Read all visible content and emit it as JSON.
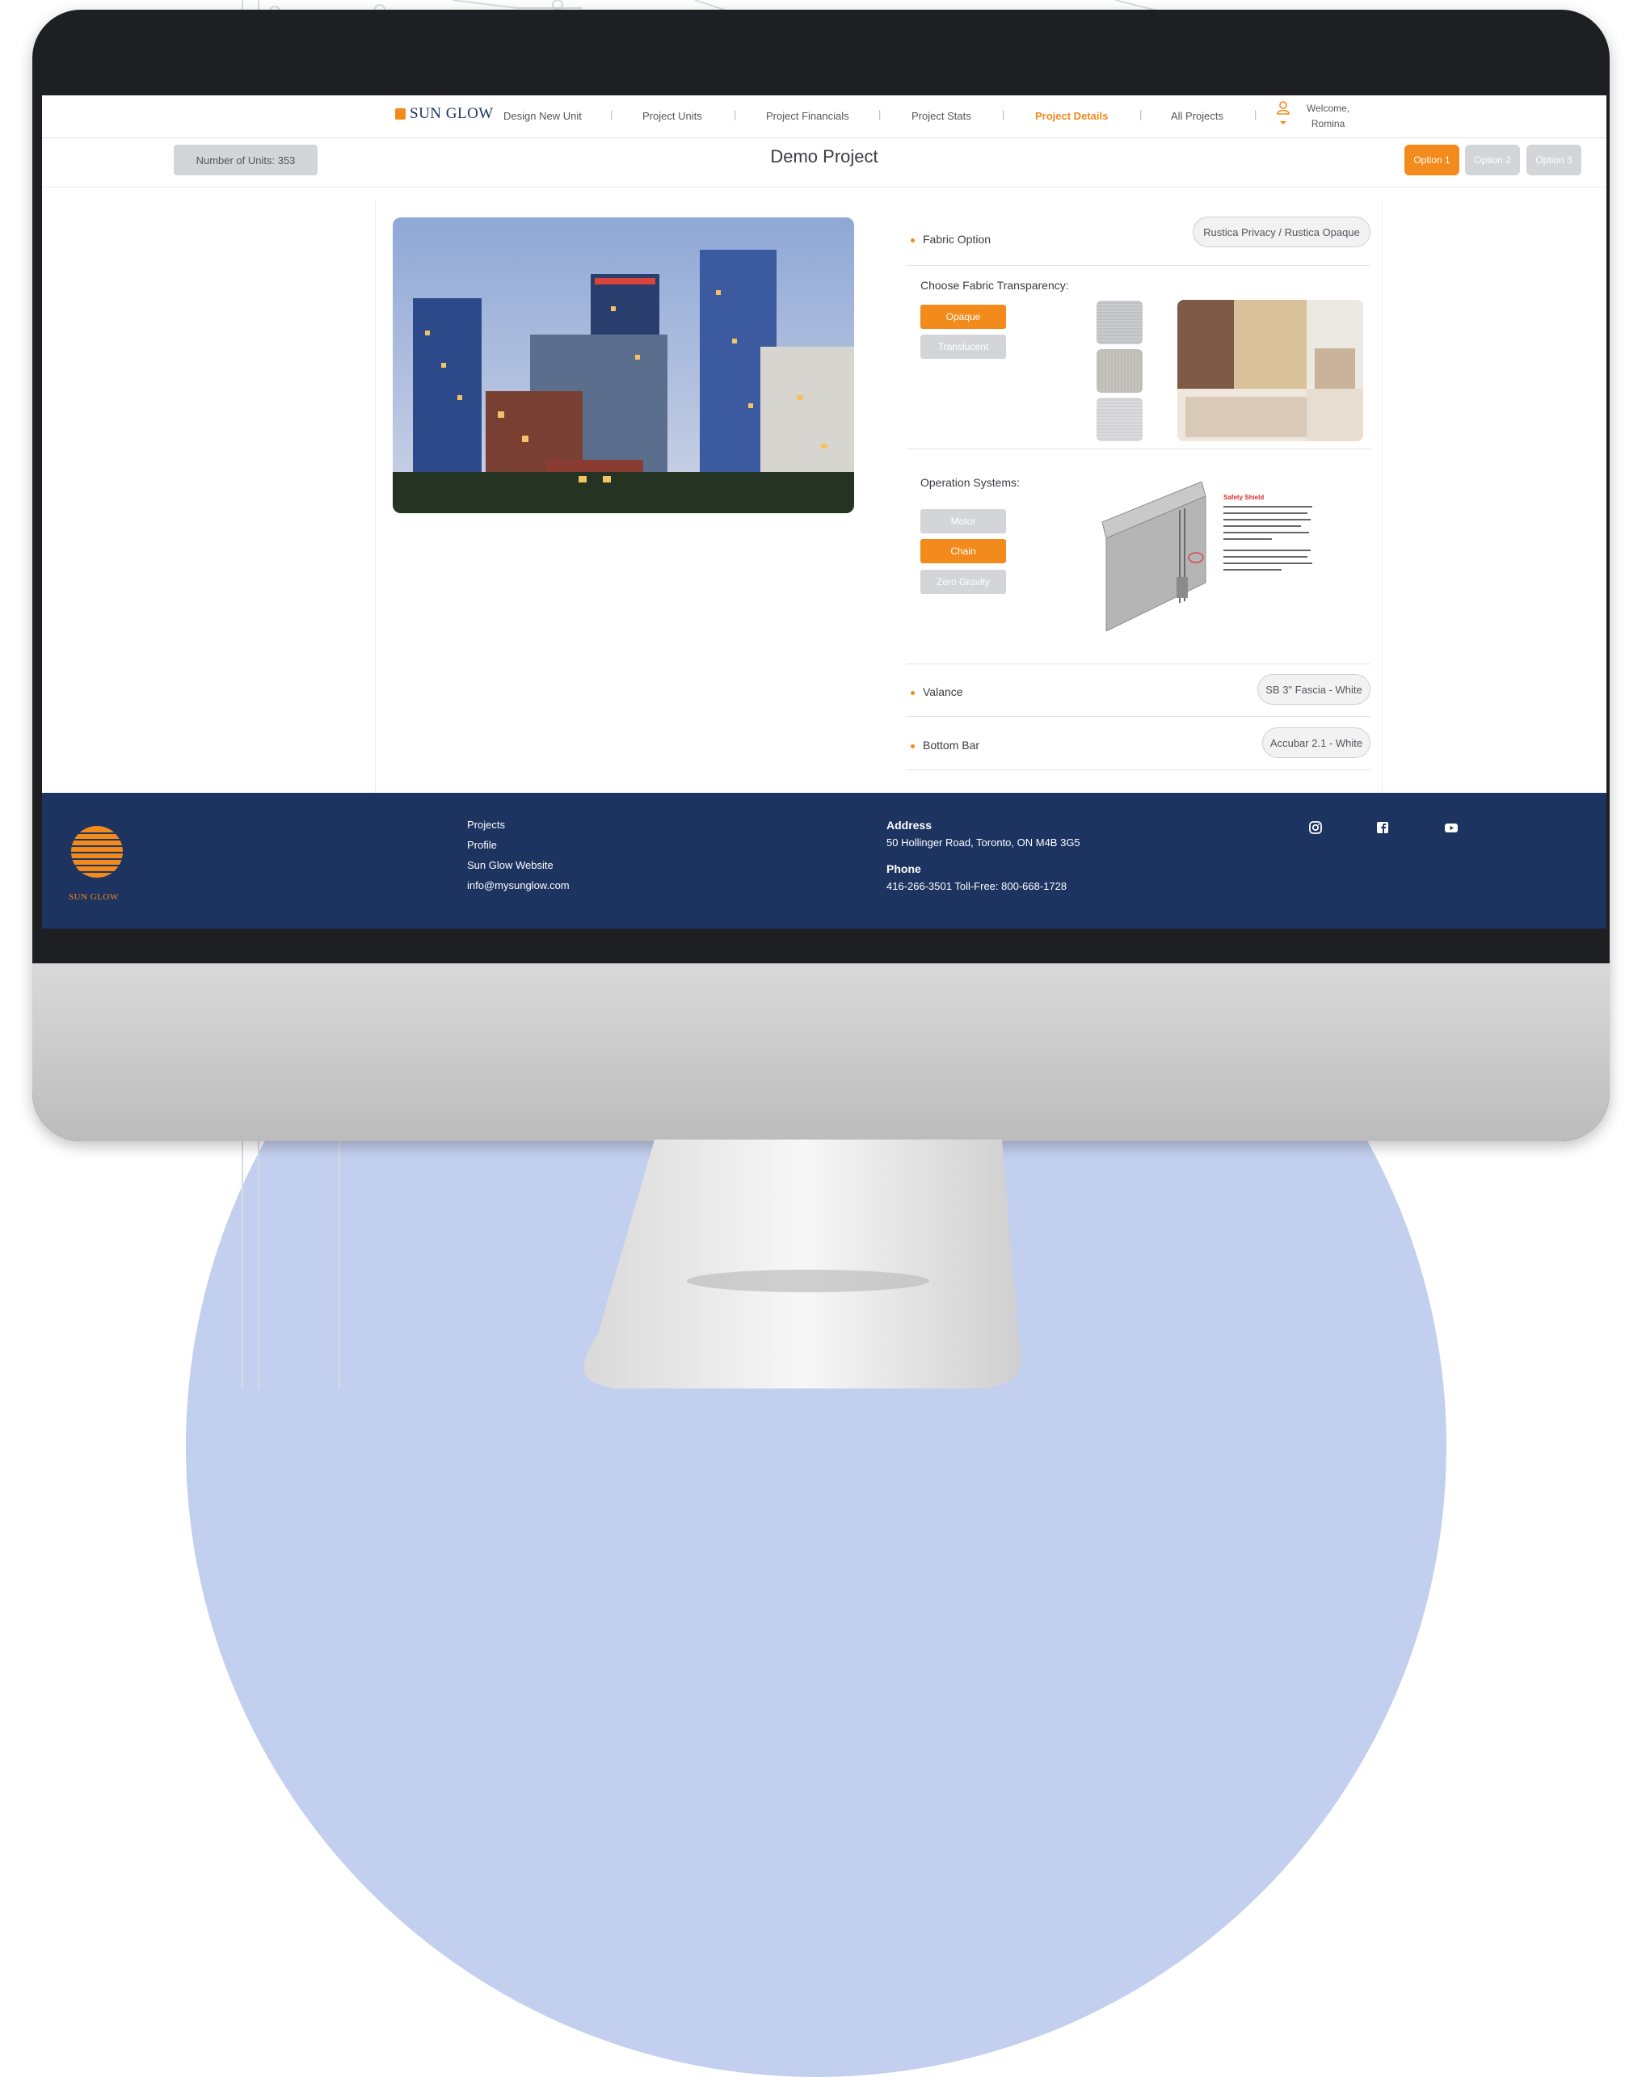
{
  "nav": {
    "brand": "SUN GLOW",
    "links": [
      "Design New Unit",
      "Project Units",
      "Project Financials",
      "Project Stats",
      "Project Details",
      "All Projects"
    ],
    "active": "Project Details",
    "separator": "|",
    "welcome_line1": "Welcome,",
    "welcome_line2": "Romina"
  },
  "subbar": {
    "units": "Number of Units: 353",
    "title": "Demo Project",
    "options": [
      "Option 1",
      "Option 2",
      "Option 3"
    ],
    "active_option": "Option 1"
  },
  "details": {
    "fabric_option_label": "Fabric Option",
    "fabric_option_value": "Rustica Privacy / Rustica Opaque",
    "transparency_title": "Choose Fabric Transparency:",
    "transparency_choices": [
      "Opaque",
      "Translucent"
    ],
    "transparency_selected": "Opaque",
    "operation_title": "Operation Systems:",
    "operation_choices": [
      "Motor",
      "Chain",
      "Zero Gravity"
    ],
    "operation_selected": "Chain",
    "safety_shield_title": "Safety Shield",
    "valance_label": "Valance",
    "valance_value": "SB 3\" Fascia - White",
    "bottom_bar_label": "Bottom Bar",
    "bottom_bar_value": "Accubar 2.1 - White"
  },
  "footer": {
    "logo_text": "SUN GLOW",
    "links": [
      "Projects",
      "Profile",
      "Sun Glow Website",
      "info@mysunglow.com"
    ],
    "address_label": "Address",
    "address": "50 Hollinger Road, Toronto, ON M4B 3G5",
    "phone_label": "Phone",
    "phone": "416-266-3501 Toll-Free: 800-668-1728",
    "social_icons": [
      "instagram-icon",
      "facebook-icon",
      "youtube-icon"
    ]
  },
  "colors": {
    "accent": "#f28a1c",
    "footer_bg": "#1d3360",
    "inactive_button": "#d4d5d8",
    "text": "#3b3c41"
  }
}
